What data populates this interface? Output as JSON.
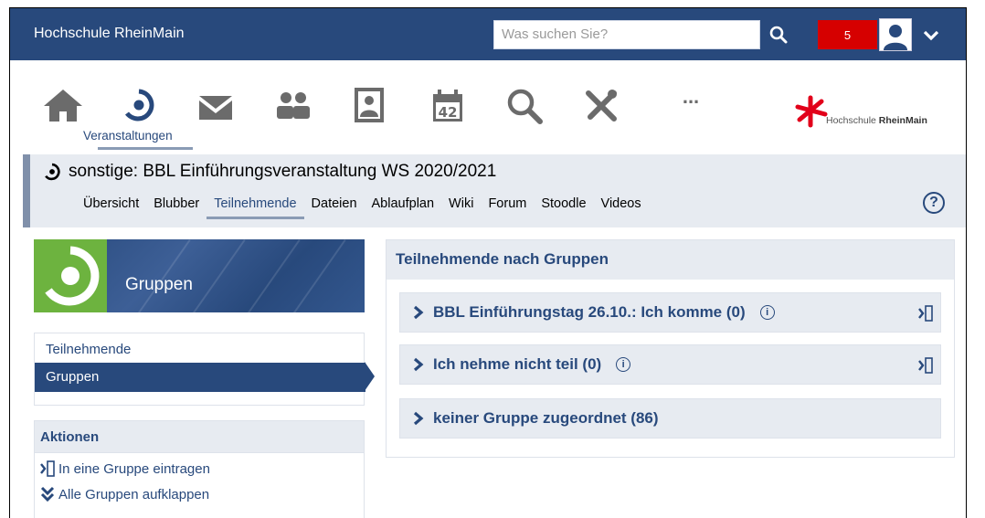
{
  "header": {
    "brand": "Hochschule RheinMain",
    "search_placeholder": "Was suchen Sie?",
    "notification_count": "5"
  },
  "nav": {
    "active_label": "Veranstaltungen",
    "icons": [
      "home-icon",
      "courses-icon",
      "messages-icon",
      "community-icon",
      "profile-icon",
      "calendar-icon",
      "search-icon",
      "tools-icon",
      "more-icon"
    ],
    "calendar_day": "42",
    "more_glyph": "..."
  },
  "logo": {
    "text_light": "Hochschule ",
    "text_bold": "RheinMain"
  },
  "course": {
    "title": "sonstige: BBL Einführungsveranstaltung WS 2020/2021",
    "tabs": [
      {
        "label": "Übersicht",
        "active": false
      },
      {
        "label": "Blubber",
        "active": false
      },
      {
        "label": "Teilnehmende",
        "active": true
      },
      {
        "label": "Dateien",
        "active": false
      },
      {
        "label": "Ablaufplan",
        "active": false
      },
      {
        "label": "Wiki",
        "active": false
      },
      {
        "label": "Forum",
        "active": false
      },
      {
        "label": "Stoodle",
        "active": false
      },
      {
        "label": "Videos",
        "active": false
      }
    ],
    "help_glyph": "?"
  },
  "sidebar": {
    "banner_title": "Gruppen",
    "items": [
      {
        "label": "Teilnehmende"
      },
      {
        "label": "Gruppen"
      }
    ],
    "actions_title": "Aktionen",
    "actions": [
      {
        "label": "In eine Gruppe eintragen",
        "icon": "join-group-icon"
      },
      {
        "label": "Alle Gruppen aufklappen",
        "icon": "expand-all-icon"
      }
    ]
  },
  "main": {
    "panel_title": "Teilnehmende nach Gruppen",
    "info_glyph": "i",
    "groups": [
      {
        "label": "BBL Einführungstag 26.10.: Ich komme (0)",
        "info": true,
        "join": true
      },
      {
        "label": "Ich nehme nicht teil (0)",
        "info": true,
        "join": true
      },
      {
        "label": "keiner Gruppe zugeordnet (86)",
        "info": false,
        "join": false
      }
    ]
  },
  "colors": {
    "primary": "#28497c",
    "accent_green": "#6db33f",
    "notification_red": "#d60000",
    "light_panel": "#e7ebf1",
    "logo_red": "#e2001a"
  }
}
